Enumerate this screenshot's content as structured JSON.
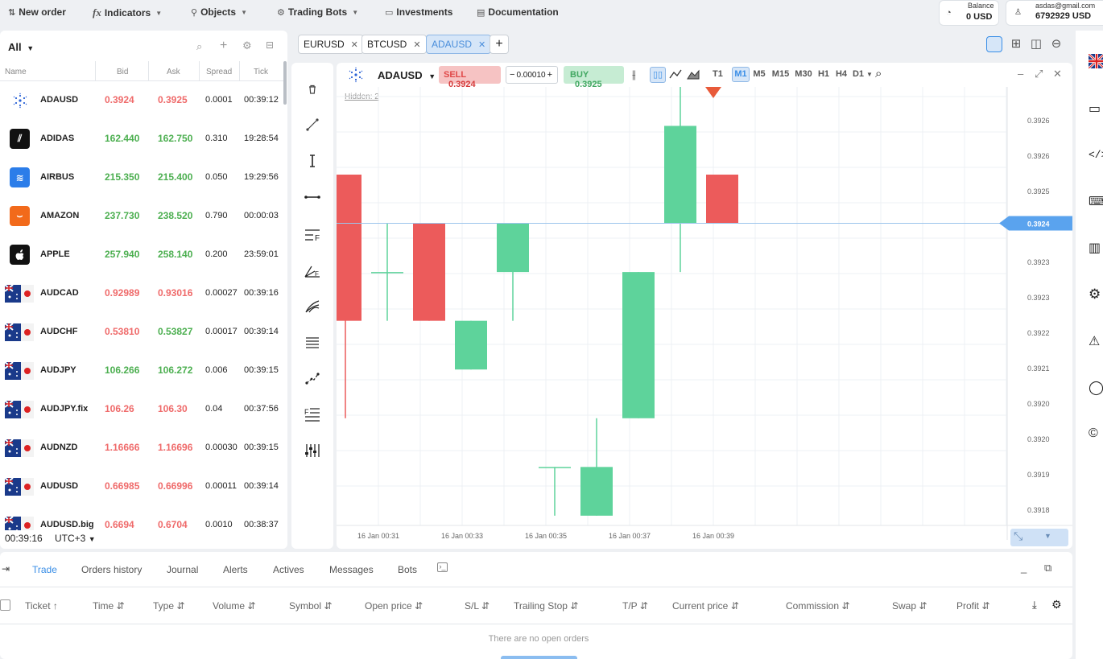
{
  "topbar": {
    "new_order": "New order",
    "indicators": "Indicators",
    "objects": "Objects",
    "trading_bots": "Trading Bots",
    "investments": "Investments",
    "documentation": "Documentation",
    "balance_label": "Balance",
    "balance_value": "0 USD",
    "account_email": "asdas@gmail.com",
    "account_value": "6792929 USD"
  },
  "watchlist": {
    "filter": "All",
    "columns": [
      "Name",
      "Bid",
      "Ask",
      "Spread",
      "Tick"
    ],
    "rows": [
      {
        "name": "ADAUSD",
        "bid": "0.3924",
        "ask": "0.3925",
        "spread": "0.0001",
        "tick": "00:39:12",
        "color": "red",
        "logo": "cardano"
      },
      {
        "name": "ADIDAS",
        "bid": "162.440",
        "ask": "162.750",
        "spread": "0.310",
        "tick": "19:28:54",
        "color": "green",
        "logo": "adidas"
      },
      {
        "name": "AIRBUS",
        "bid": "215.350",
        "ask": "215.400",
        "spread": "0.050",
        "tick": "19:29:56",
        "color": "green",
        "logo": "airbus"
      },
      {
        "name": "AMAZON",
        "bid": "237.730",
        "ask": "238.520",
        "spread": "0.790",
        "tick": "00:00:03",
        "color": "green",
        "logo": "amazon"
      },
      {
        "name": "APPLE",
        "bid": "257.940",
        "ask": "258.140",
        "spread": "0.200",
        "tick": "23:59:01",
        "color": "green",
        "logo": "apple"
      },
      {
        "name": "AUDCAD",
        "bid": "0.92989",
        "ask": "0.93016",
        "spread": "0.00027",
        "tick": "00:39:16",
        "color": "red",
        "logo": "flag-au-ca"
      },
      {
        "name": "AUDCHF",
        "bid": "0.53810",
        "ask": "0.53827",
        "spread": "0.00017",
        "tick": "00:39:14",
        "color": "red-green",
        "logo": "flag-au-ch"
      },
      {
        "name": "AUDJPY",
        "bid": "106.266",
        "ask": "106.272",
        "spread": "0.006",
        "tick": "00:39:15",
        "color": "green",
        "logo": "flag-au-jp"
      },
      {
        "name": "AUDJPY.fix",
        "bid": "106.26",
        "ask": "106.30",
        "spread": "0.04",
        "tick": "00:37:56",
        "color": "red",
        "logo": "flag-au-jp"
      },
      {
        "name": "AUDNZD",
        "bid": "1.16666",
        "ask": "1.16696",
        "spread": "0.00030",
        "tick": "00:39:15",
        "color": "red",
        "logo": "flag-au-nz"
      },
      {
        "name": "AUDUSD",
        "bid": "0.66985",
        "ask": "0.66996",
        "spread": "0.00011",
        "tick": "00:39:14",
        "color": "red",
        "logo": "flag-au"
      },
      {
        "name": "AUDUSD.big",
        "bid": "0.6694",
        "ask": "0.6704",
        "spread": "0.0010",
        "tick": "00:38:37",
        "color": "red",
        "logo": "flag-au-us"
      }
    ],
    "clock": "00:39:16",
    "timezone": "UTC+3"
  },
  "tabs": [
    "EURUSD",
    "BTCUSD",
    "ADAUSD"
  ],
  "chart_header": {
    "symbol": "ADAUSD",
    "sell_label": "SELL",
    "sell_price": "0.3924",
    "lot": "0.00010",
    "buy_label": "BUY",
    "buy_price": "0.3925",
    "timeframes": [
      "T1",
      "M1",
      "M5",
      "M15",
      "M30",
      "H1",
      "H4",
      "D1"
    ],
    "active_timeframe": "M1",
    "hidden": "Hidden: 2"
  },
  "chart_data": {
    "type": "candlestick",
    "symbol": "ADAUSD",
    "y_ticks": [
      "0.3926",
      "0.3926",
      "0.3925",
      "0.3924",
      "0.3923",
      "0.3923",
      "0.3922",
      "0.3921",
      "0.3920",
      "0.3920",
      "0.3919",
      "0.3918"
    ],
    "current_price": "0.3924",
    "x_ticks": [
      "16 Jan 00:31",
      "16 Jan 00:33",
      "16 Jan 00:35",
      "16 Jan 00:37",
      "16 Jan 00:39"
    ],
    "ylim": [
      0.39178,
      0.39268
    ],
    "candles": [
      {
        "o": 0.3925,
        "h": 0.3925,
        "l": 0.392,
        "c": 0.3922
      },
      {
        "o": 0.3923,
        "h": 0.3924,
        "l": 0.3922,
        "c": 0.3923
      },
      {
        "o": 0.3924,
        "h": 0.3924,
        "l": 0.3922,
        "c": 0.3922
      },
      {
        "o": 0.3921,
        "h": 0.3922,
        "l": 0.3921,
        "c": 0.3922
      },
      {
        "o": 0.3923,
        "h": 0.3924,
        "l": 0.3922,
        "c": 0.3924
      },
      {
        "o": 0.3919,
        "h": 0.3919,
        "l": 0.3918,
        "c": 0.3919
      },
      {
        "o": 0.3918,
        "h": 0.392,
        "l": 0.3918,
        "c": 0.3919
      },
      {
        "o": 0.392,
        "h": 0.3923,
        "l": 0.392,
        "c": 0.3923
      },
      {
        "o": 0.3924,
        "h": 0.3927,
        "l": 0.3923,
        "c": 0.3926
      },
      {
        "o": 0.3925,
        "h": 0.3925,
        "l": 0.3924,
        "c": 0.3924
      }
    ]
  },
  "bottom": {
    "tabs": [
      "Trade",
      "Orders history",
      "Journal",
      "Alerts",
      "Actives",
      "Messages",
      "Bots"
    ],
    "active_tab": "Trade",
    "columns": [
      "Ticket",
      "Time",
      "Type",
      "Volume",
      "Symbol",
      "Open price",
      "S/L",
      "Trailing Stop",
      "T/P",
      "Current price",
      "Commission",
      "Swap",
      "Profit"
    ],
    "empty_message": "There are no open orders"
  },
  "colors": {
    "accent": "#3a8ee6",
    "buy_green": "#5ed39b",
    "sell_red": "#ec5b5b"
  }
}
